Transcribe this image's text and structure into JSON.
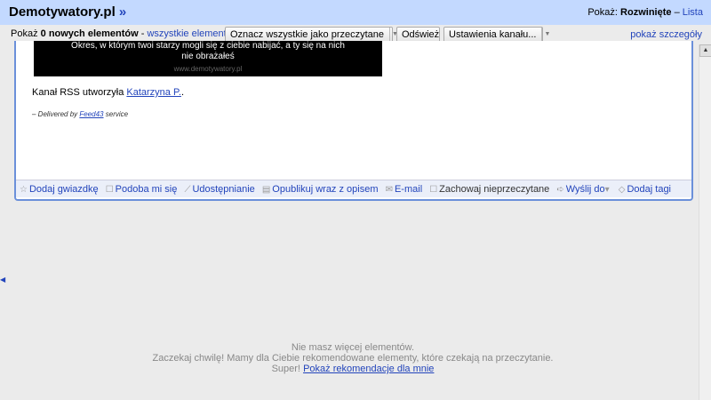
{
  "header": {
    "feed_title": "Demotywatory.pl",
    "feed_arrow": "»",
    "show_label": "Pokaż:",
    "view_expanded": "Rozwinięte",
    "separator": "–",
    "view_list": "Lista"
  },
  "toolbar": {
    "show_prefix": "Pokaż",
    "new_items": "0 nowych elementów",
    "dash": "-",
    "all_items": "wszystkie elementy",
    "mark_all_read": "Oznacz wszystkie jako przeczytane",
    "refresh": "Odśwież",
    "feed_settings": "Ustawienia kanału...",
    "show_details": "pokaż szczegóły"
  },
  "entry": {
    "image_caption_line1": "Okres, w którym twoi starzy mogli się z ciebie nabijać, a ty się na nich",
    "image_caption_line2": "nie obrażałeś",
    "image_watermark": "www.demotywatory.pl",
    "rss_created_prefix": "Kanał RSS utworzyła",
    "rss_author": "Katarzyna P.",
    "rss_created_suffix": ".",
    "delivered_prefix": "– Delivered by",
    "delivered_service": "Feed43",
    "delivered_suffix": "service",
    "actions": {
      "star": "Dodaj gwiazdkę",
      "like": "Podoba mi się",
      "share": "Udostępnianie",
      "share_note": "Opublikuj wraz z opisem",
      "email": "E-mail",
      "keep_unread": "Zachowaj nieprzeczytane",
      "send_to": "Wyślij do",
      "add_tags": "Dodaj tagi"
    }
  },
  "empty": {
    "line1": "Nie masz więcej elementów.",
    "line2": "Zaczekaj chwilę! Mamy dla Ciebie rekomendowane elementy, które czekają na przeczytanie.",
    "line3_prefix": "Super!",
    "line3_link": "Pokaż rekomendacje dla mnie"
  }
}
